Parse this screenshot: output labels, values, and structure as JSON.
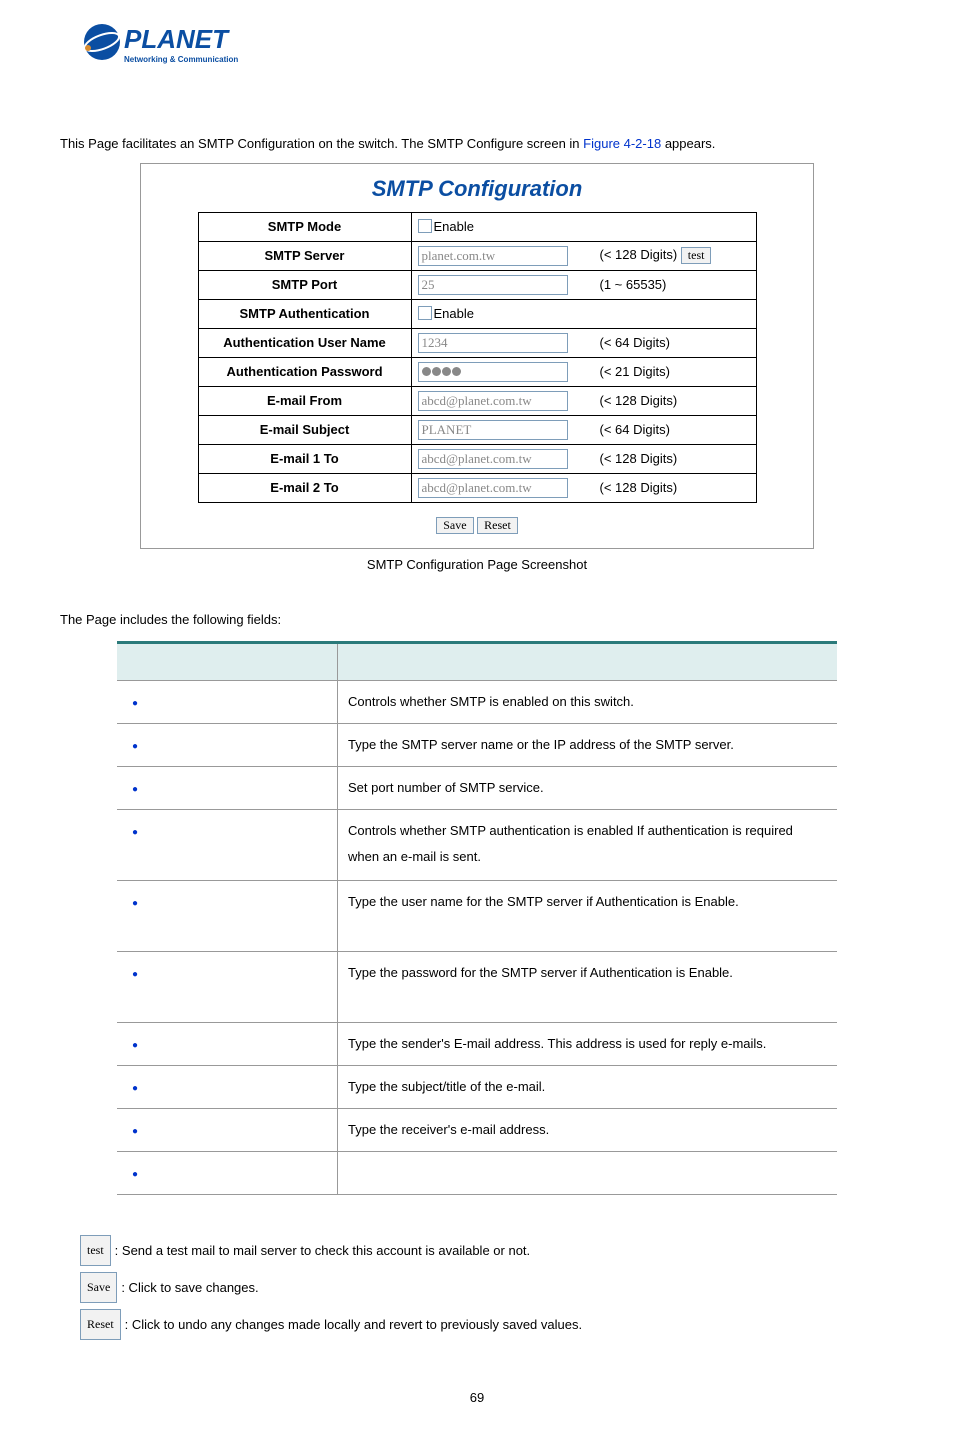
{
  "logo": {
    "brand": "PLANET",
    "tagline": "Networking & Communication"
  },
  "intro": {
    "pre": "This Page facilitates an SMTP Configuration on the switch. The SMTP Configure screen in ",
    "figref": "Figure 4-2-18",
    "post": " appears."
  },
  "config": {
    "title": "SMTP Configuration",
    "rows": [
      {
        "label": "SMTP Mode",
        "type": "checkbox",
        "text": "Enable"
      },
      {
        "label": "SMTP Server",
        "type": "input",
        "value": "planet.com.tw",
        "hint": "(< 128 Digits)",
        "extra_btn": "test"
      },
      {
        "label": "SMTP Port",
        "type": "input",
        "value": "25",
        "hint": "(1 ~ 65535)"
      },
      {
        "label": "SMTP Authentication",
        "type": "checkbox",
        "text": "Enable"
      },
      {
        "label": "Authentication User Name",
        "type": "input",
        "value": "1234",
        "hint": "(< 64 Digits)"
      },
      {
        "label": "Authentication Password",
        "type": "password",
        "hint": "(< 21 Digits)"
      },
      {
        "label": "E-mail From",
        "type": "input",
        "value": "abcd@planet.com.tw",
        "hint": "(< 128 Digits)"
      },
      {
        "label": "E-mail Subject",
        "type": "input",
        "value": "PLANET",
        "hint": "(< 64 Digits)"
      },
      {
        "label": "E-mail 1 To",
        "type": "input",
        "value": "abcd@planet.com.tw",
        "hint": "(< 128 Digits)"
      },
      {
        "label": "E-mail 2 To",
        "type": "input",
        "value": "abcd@planet.com.tw",
        "hint": "(< 128 Digits)"
      }
    ],
    "save": "Save",
    "reset": "Reset"
  },
  "caption": "SMTP Configuration Page Screenshot",
  "fields_intro": "The Page includes the following fields:",
  "fields_table": [
    {
      "desc": "Controls whether SMTP is enabled on this switch."
    },
    {
      "desc": "Type the SMTP server name or the IP address of the SMTP server."
    },
    {
      "desc": "Set port number of SMTP service."
    },
    {
      "desc": "Controls whether SMTP authentication is enabled If authentication is required when an e-mail is sent."
    },
    {
      "desc": "Type the user name for the SMTP server if Authentication is Enable."
    },
    {
      "desc": "Type the password for the SMTP server if Authentication is Enable."
    },
    {
      "desc": "Type the sender's E-mail address. This address is used for reply e-mails."
    },
    {
      "desc": "Type the subject/title of the e-mail."
    },
    {
      "desc": "Type the receiver's e-mail address."
    },
    {
      "desc": ""
    }
  ],
  "buttons": {
    "test": {
      "label": "test",
      "desc": ": Send a test mail to mail server to check this account is available or not."
    },
    "save": {
      "label": "Save",
      "desc": ": Click to save changes."
    },
    "reset": {
      "label": "Reset",
      "desc": ": Click to undo any changes made locally and revert to previously saved values."
    }
  },
  "page_number": "69"
}
